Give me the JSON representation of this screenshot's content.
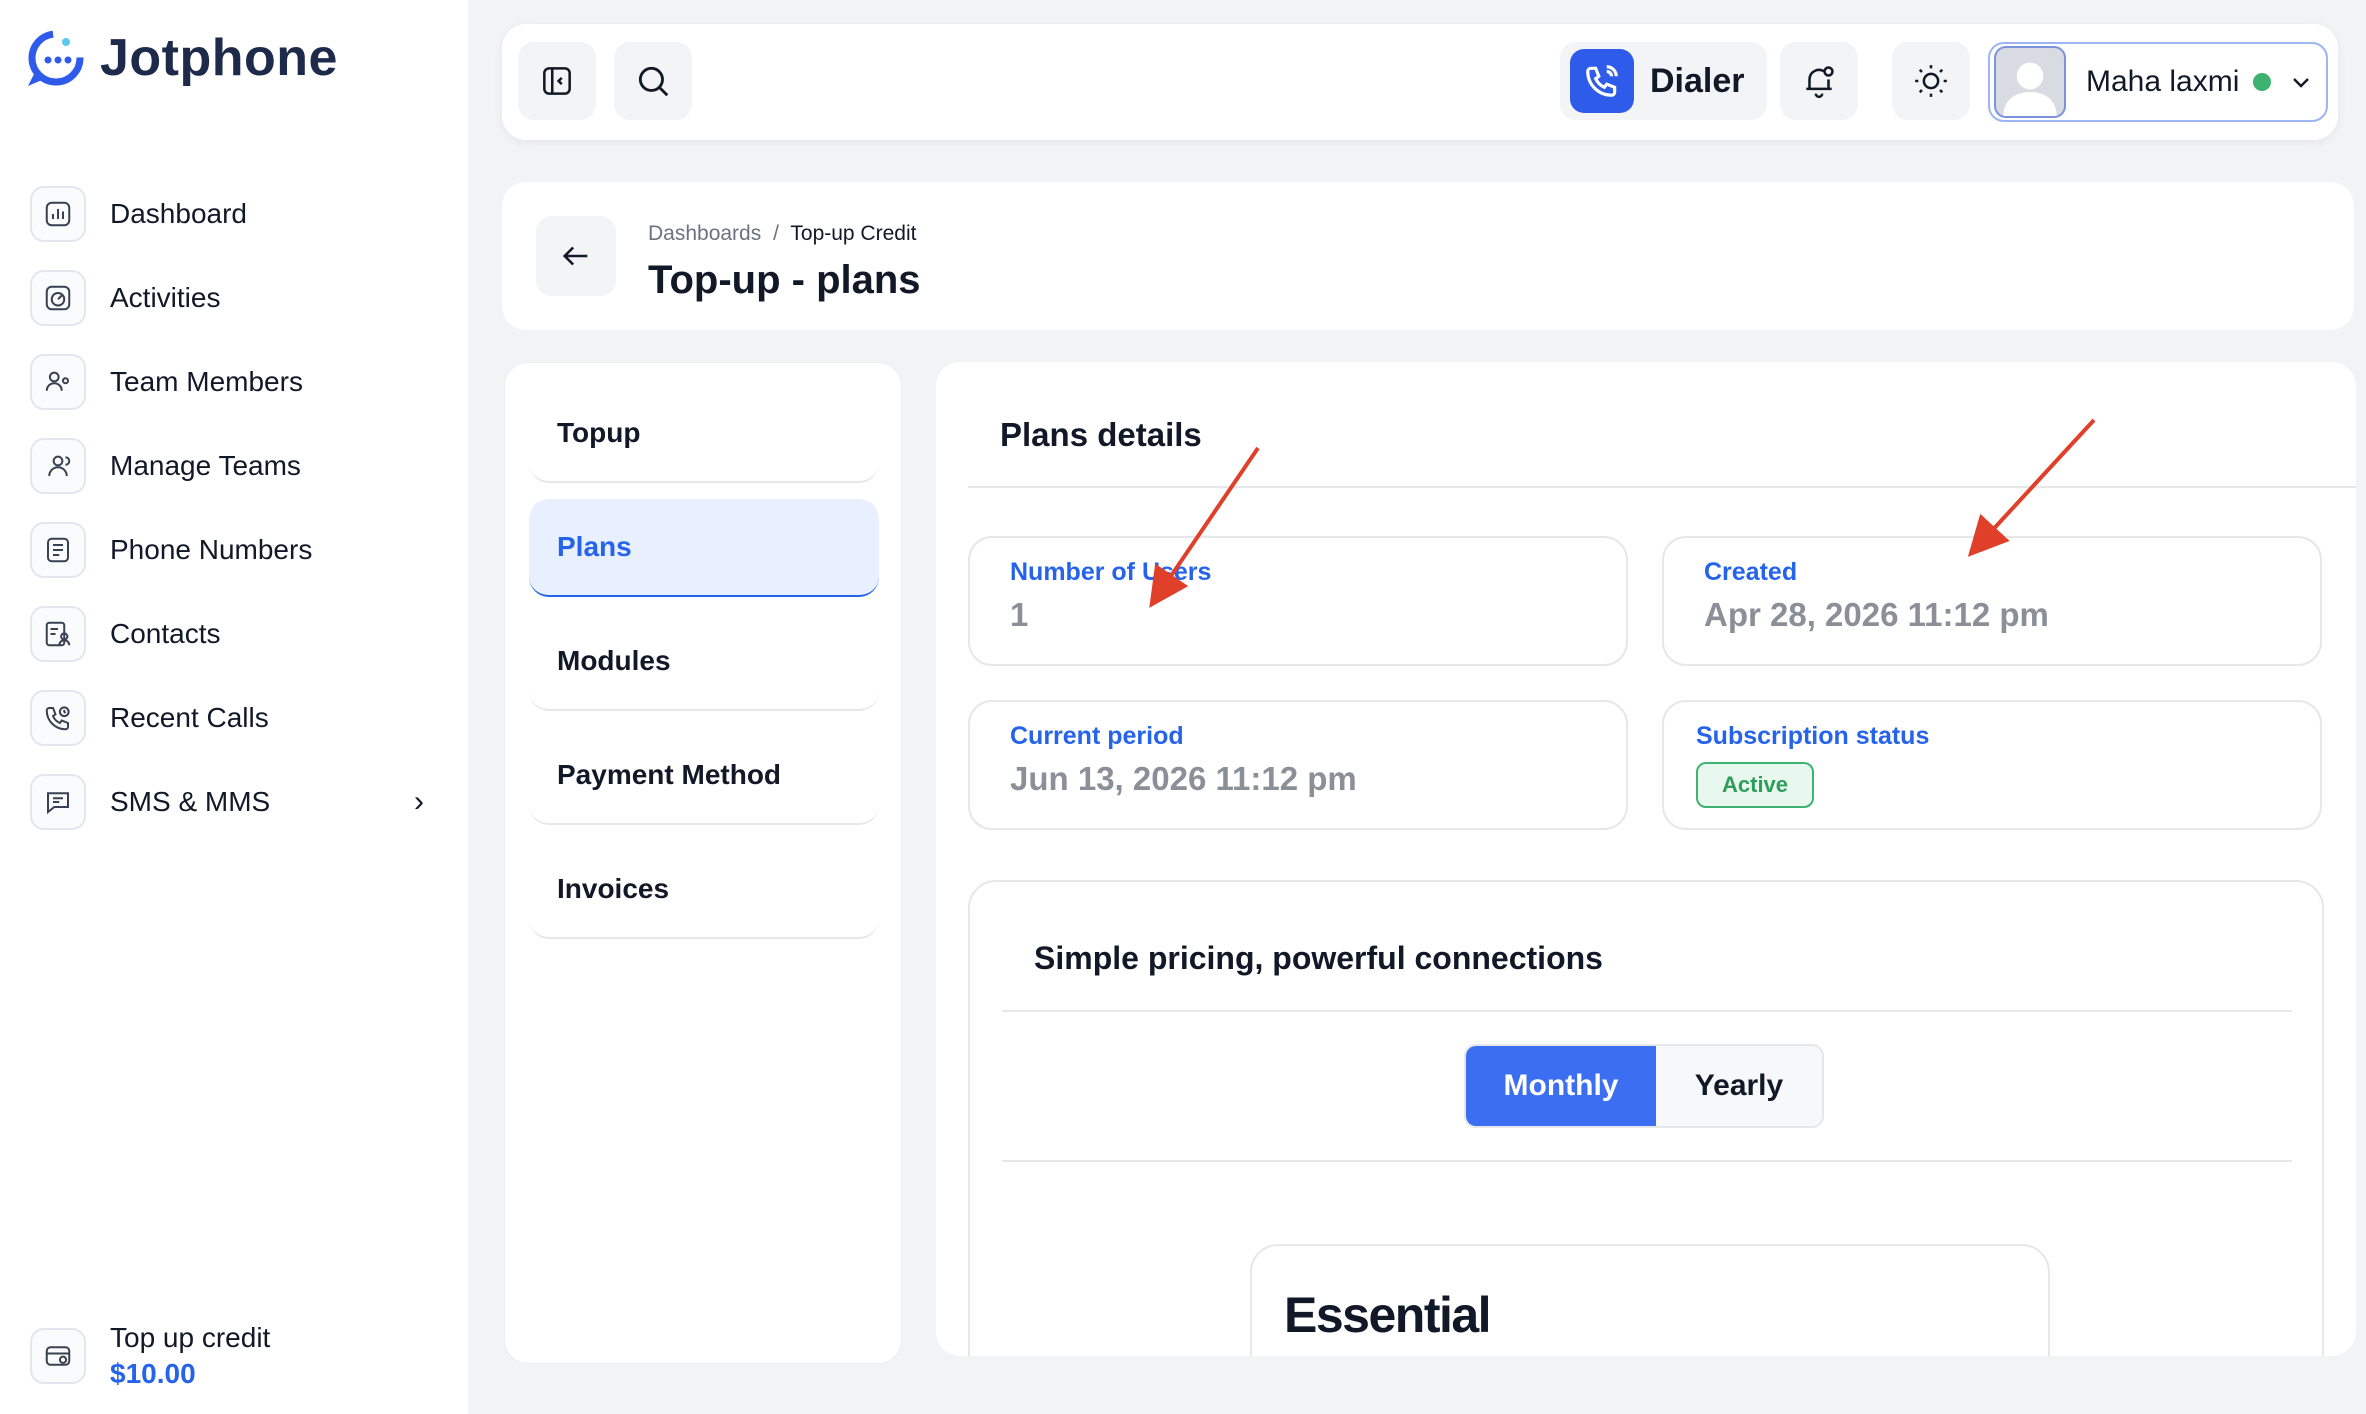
{
  "brand": {
    "name": "Jotphone",
    "accent": "#2563eb"
  },
  "sidebar": {
    "items": [
      {
        "label": "Dashboard",
        "icon": "chart-icon"
      },
      {
        "label": "Activities",
        "icon": "gauge-icon"
      },
      {
        "label": "Team Members",
        "icon": "user-gear-icon"
      },
      {
        "label": "Manage Teams",
        "icon": "users-icon"
      },
      {
        "label": "Phone Numbers",
        "icon": "list-icon"
      },
      {
        "label": "Contacts",
        "icon": "contact-card-icon"
      },
      {
        "label": "Recent Calls",
        "icon": "phone-recent-icon"
      },
      {
        "label": "SMS & MMS",
        "icon": "message-icon"
      }
    ],
    "topup": {
      "title": "Top up credit",
      "amount": "$10.00"
    }
  },
  "header": {
    "dialer_label": "Dialer",
    "user_name": "Maha laxmi",
    "status_color": "#3cb371"
  },
  "title_card": {
    "breadcrumb_root": "Dashboards",
    "breadcrumb_sep": "/",
    "breadcrumb_current": "Top-up Credit",
    "title": "Top-up - plans"
  },
  "tabs": [
    {
      "label": "Topup"
    },
    {
      "label": "Plans"
    },
    {
      "label": "Modules"
    },
    {
      "label": "Payment Method"
    },
    {
      "label": "Invoices"
    }
  ],
  "plans_details": {
    "title": "Plans details",
    "users_label": "Number of Users",
    "users_value": "1",
    "created_label": "Created",
    "created_value": "Apr 28, 2026 11:12 pm",
    "period_label": "Current period",
    "period_value": "Jun 13, 2026 11:12 pm",
    "status_label": "Subscription status",
    "status_value": "Active"
  },
  "pricing": {
    "title": "Simple pricing, powerful connections",
    "monthly": "Monthly",
    "yearly": "Yearly",
    "plan_name": "Essential"
  }
}
